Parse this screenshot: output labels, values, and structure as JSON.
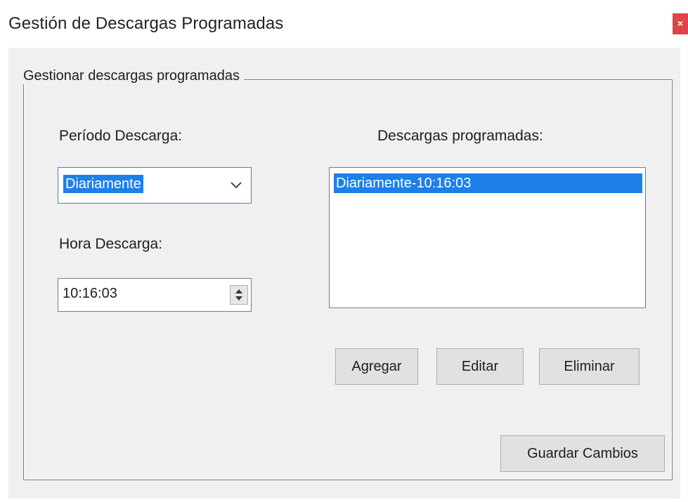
{
  "window": {
    "title": "Gestión de Descargas Programadas",
    "close_glyph": "×"
  },
  "group": {
    "label": "Gestionar descargas programadas"
  },
  "period": {
    "label": "Período Descarga:",
    "selected": "Diariamente"
  },
  "time": {
    "label": "Hora Descarga:",
    "value": "10:16:03"
  },
  "scheduled": {
    "label": "Descargas programadas:",
    "items": [
      "Diariamente-10:16:03"
    ]
  },
  "buttons": {
    "add": "Agregar",
    "edit": "Editar",
    "delete": "Eliminar",
    "save": "Guardar Cambios"
  },
  "colors": {
    "selection": "#1e7fe8",
    "close_button": "#e04343"
  },
  "icons": {
    "dropdown": "chevron-down-icon",
    "spinner": "spinner-arrows-icon",
    "close": "close-icon"
  }
}
